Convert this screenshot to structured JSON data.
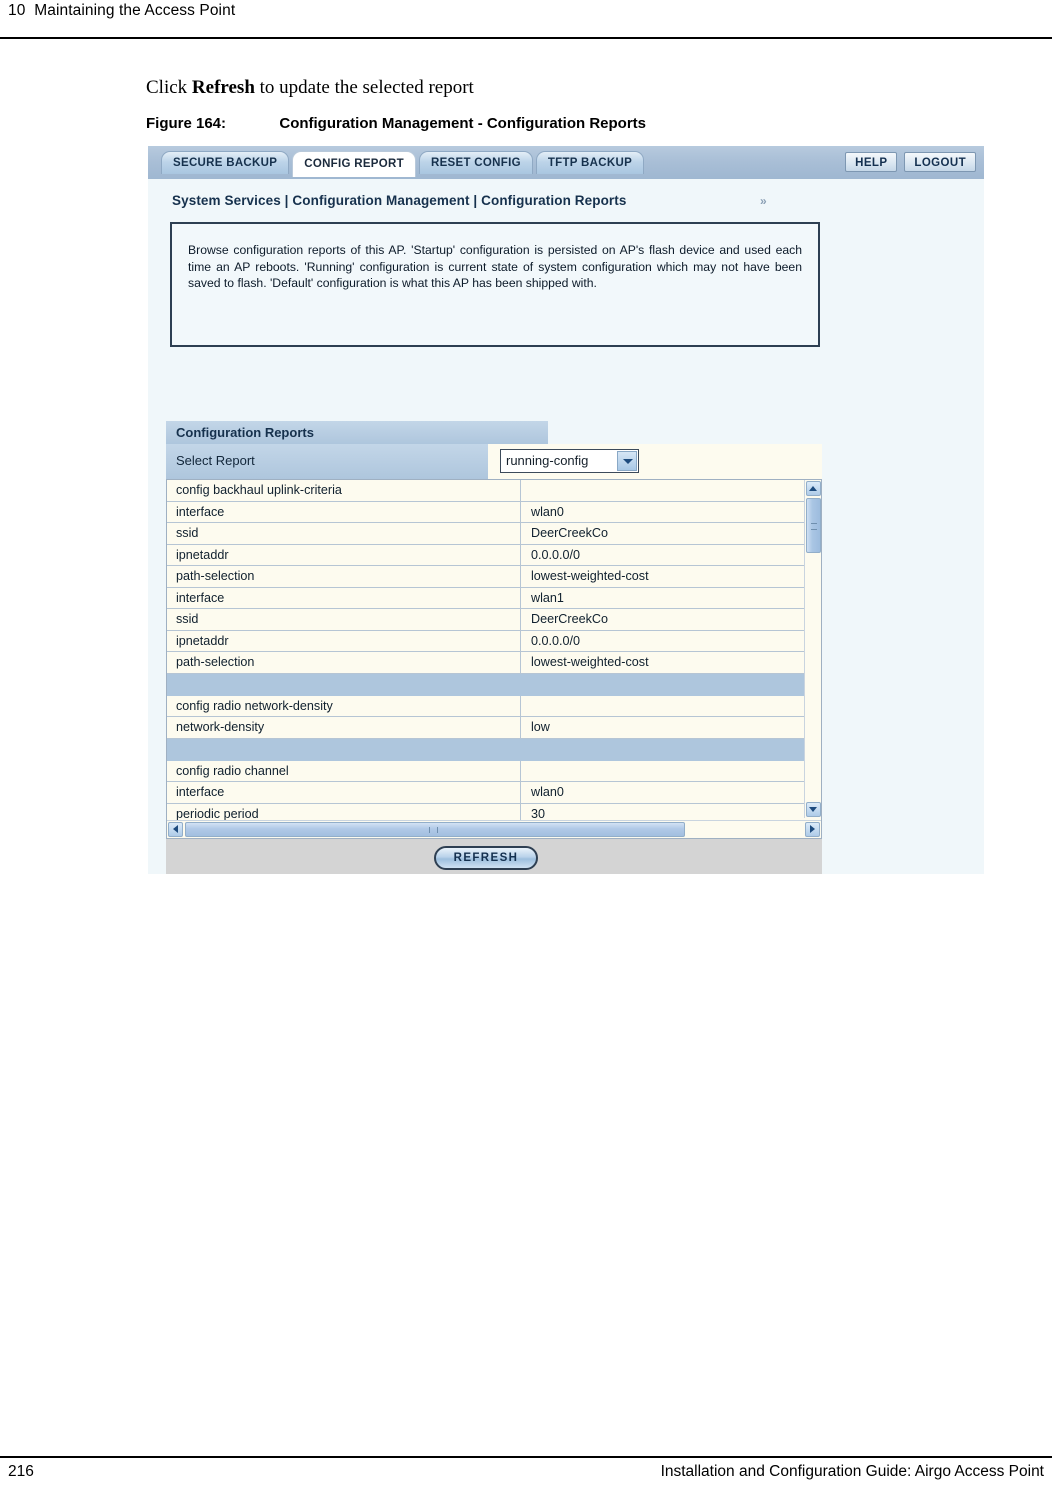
{
  "page": {
    "header": "10  Maintaining the Access Point",
    "footer_number": "216",
    "footer_title": "Installation and Configuration Guide: Airgo Access Point",
    "paragraph_prefix": "Click ",
    "paragraph_bold": "Refresh",
    "paragraph_suffix": " to update the selected report",
    "figure_label": "Figure 164:",
    "figure_title": "Configuration Management - Configuration Reports"
  },
  "app": {
    "tabs": [
      {
        "label": "SECURE BACKUP",
        "active": false
      },
      {
        "label": "CONFIG REPORT",
        "active": true
      },
      {
        "label": "RESET CONFIG",
        "active": false
      },
      {
        "label": "TFTP BACKUP",
        "active": false
      }
    ],
    "help_label": "HELP",
    "logout_label": "LOGOUT",
    "breadcrumb": "System Services | Configuration Management | Configuration Reports",
    "breadcrumb_chevrons": "»",
    "description": "Browse configuration reports of this AP. 'Startup' configuration is persisted on AP's flash device and used each time an AP reboots. 'Running' configuration is current state of system configuration which may not have been saved to flash. 'Default' configuration is what this AP has been shipped with.",
    "section_title": "Configuration Reports",
    "select_report_label": "Select Report",
    "select_report_value": "running-config",
    "refresh_label": "REFRESH",
    "report_rows": [
      {
        "key": "config backhaul uplink-criteria",
        "value": "",
        "spacer": false
      },
      {
        "key": "interface",
        "value": "wlan0",
        "spacer": false
      },
      {
        "key": "ssid",
        "value": "DeerCreekCo",
        "spacer": false
      },
      {
        "key": "ipnetaddr",
        "value": "0.0.0.0/0",
        "spacer": false
      },
      {
        "key": "path-selection",
        "value": "lowest-weighted-cost",
        "spacer": false
      },
      {
        "key": "interface",
        "value": "wlan1",
        "spacer": false
      },
      {
        "key": "ssid",
        "value": "DeerCreekCo",
        "spacer": false
      },
      {
        "key": "ipnetaddr",
        "value": "0.0.0.0/0",
        "spacer": false
      },
      {
        "key": "path-selection",
        "value": "lowest-weighted-cost",
        "spacer": false
      },
      {
        "key": "",
        "value": "",
        "spacer": true
      },
      {
        "key": "config radio network-density",
        "value": "",
        "spacer": false
      },
      {
        "key": "network-density",
        "value": "low",
        "spacer": false
      },
      {
        "key": "",
        "value": "",
        "spacer": true
      },
      {
        "key": "config radio channel",
        "value": "",
        "spacer": false
      },
      {
        "key": "interface",
        "value": "wlan0",
        "spacer": false
      },
      {
        "key": "periodic period",
        "value": "30",
        "spacer": false
      }
    ]
  },
  "colors": {
    "tab_active_bg": "#ffffff",
    "tabbar_bg": "#a8bed6",
    "section_header_bg": "#aec6dd",
    "table_bg": "#fdfbef",
    "panel_bg": "#f0f7fa"
  }
}
